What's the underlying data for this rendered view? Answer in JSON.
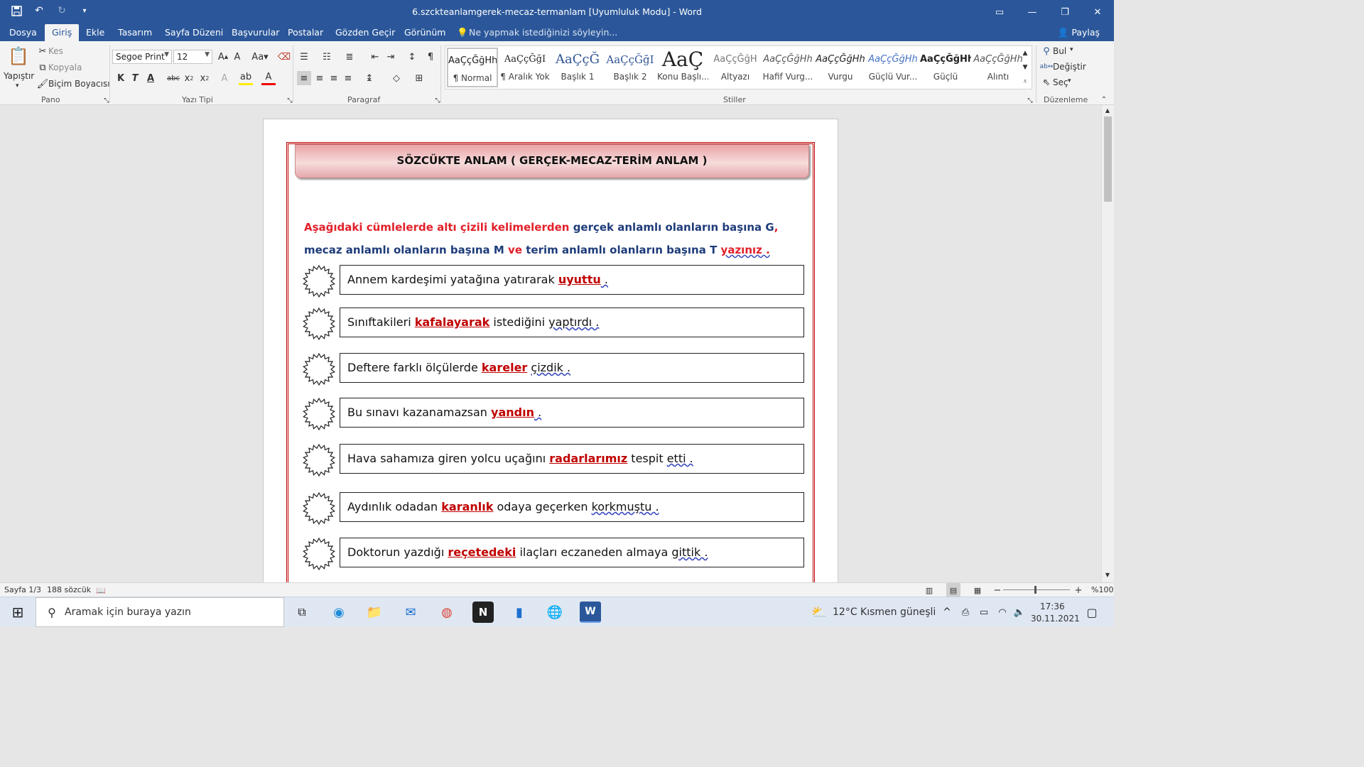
{
  "titlebar": {
    "title": "6.szckteanlamgerek-mecaz-termanlam [Uyumluluk Modu] - Word",
    "qat_icons": [
      "save-icon",
      "undo-icon",
      "redo-icon",
      "customize-icon"
    ]
  },
  "tabs": [
    "Dosya",
    "Giriş",
    "Ekle",
    "Tasarım",
    "Sayfa Düzeni",
    "Başvurular",
    "Postalar",
    "Gözden Geçir",
    "Görünüm"
  ],
  "active_tab": "Giriş",
  "tell_me": "Ne yapmak istediğinizi söyleyin...",
  "share": "Paylaş",
  "ribbon": {
    "pano": {
      "label": "Pano",
      "paste": "Yapıştır",
      "cut": "Kes",
      "copy": "Kopyala",
      "format_painter": "Biçim Boyacısı"
    },
    "font": {
      "label": "Yazı Tipi",
      "family": "Segoe Print",
      "size": "12",
      "bold": "K",
      "italic": "T",
      "underline": "A"
    },
    "paragraph": {
      "label": "Paragraf"
    },
    "styles": {
      "label": "Stiller",
      "items": [
        {
          "preview": "AaÇçĞğHh",
          "name": "¶ Normal"
        },
        {
          "preview": "AaÇçĞğI",
          "name": "¶ Aralık Yok"
        },
        {
          "preview": "AaÇçĞ",
          "name": "Başlık 1"
        },
        {
          "preview": "AaÇçĞğI",
          "name": "Başlık 2"
        },
        {
          "preview": "AaÇ",
          "name": "Konu Başlı..."
        },
        {
          "preview": "AaÇçĞğH",
          "name": "Altyazı"
        },
        {
          "preview": "AaÇçĞğHh",
          "name": "Hafif Vurg..."
        },
        {
          "preview": "AaÇçĞğHh",
          "name": "Vurgu"
        },
        {
          "preview": "AaÇçĞğHh",
          "name": "Güçlü Vur..."
        },
        {
          "preview": "AaÇçĞğHh",
          "name": "Güçlü"
        },
        {
          "preview": "AaÇçĞğHh",
          "name": "Alıntı"
        }
      ]
    },
    "editing": {
      "label": "Düzenleme",
      "find": "Bul",
      "replace": "Değiştir",
      "select": "Seç"
    }
  },
  "document": {
    "heading": "SÖZCÜKTE ANLAM ( GERÇEK-MECAZ-TERİM ANLAM )",
    "instruction": {
      "p1_red": "Aşağıdaki cümlelerde altı çizili kelimelerden",
      "p1_blue": "gerçek anlamlı olanların başına G",
      "p1_comma": ",",
      "p2_blue1": "mecaz anlamlı olanların başına M",
      "p2_red": "ve",
      "p2_blue2": "terim anlamlı olanların başına T",
      "p2_end": "yazınız ."
    },
    "items": [
      {
        "before": "Annem kardeşimi yatağına yatırarak",
        "word": "uyuttu",
        "after": "",
        "tail": " ."
      },
      {
        "before": "Sınıftakileri",
        "word": "kafalayarak",
        "after": " istediğini ",
        "tail": "yaptırdı ."
      },
      {
        "before": "Deftere farklı ölçülerde",
        "word": "kareler",
        "after": " ",
        "tail": "çizdik ."
      },
      {
        "before": "Bu sınavı kazanamazsan",
        "word": "yandın",
        "after": "",
        "tail": " ."
      },
      {
        "before": "Hava sahamıza giren yolcu uçağını",
        "word": "radarlarımız",
        "after": " tespit ",
        "tail": "etti ."
      },
      {
        "before": "Aydınlık odadan",
        "word": "karanlık",
        "after": " odaya geçerken ",
        "tail": "korkmuştu ."
      },
      {
        "before": "Doktorun yazdığı",
        "word": "reçetedeki",
        "after": " ilaçları eczaneden almaya ",
        "tail": "gittik ."
      }
    ],
    "colors": {
      "red": "#e2202a",
      "blue": "#1f3c7a",
      "frame": "#c00000"
    }
  },
  "statusbar": {
    "page": "Sayfa 1/3",
    "words": "188 sözcük",
    "zoom": "%100"
  },
  "taskbar": {
    "search_placeholder": "Aramak için buraya yazın",
    "weather": "12°C  Kısmen güneşli",
    "time": "17:36",
    "date": "30.11.2021"
  }
}
